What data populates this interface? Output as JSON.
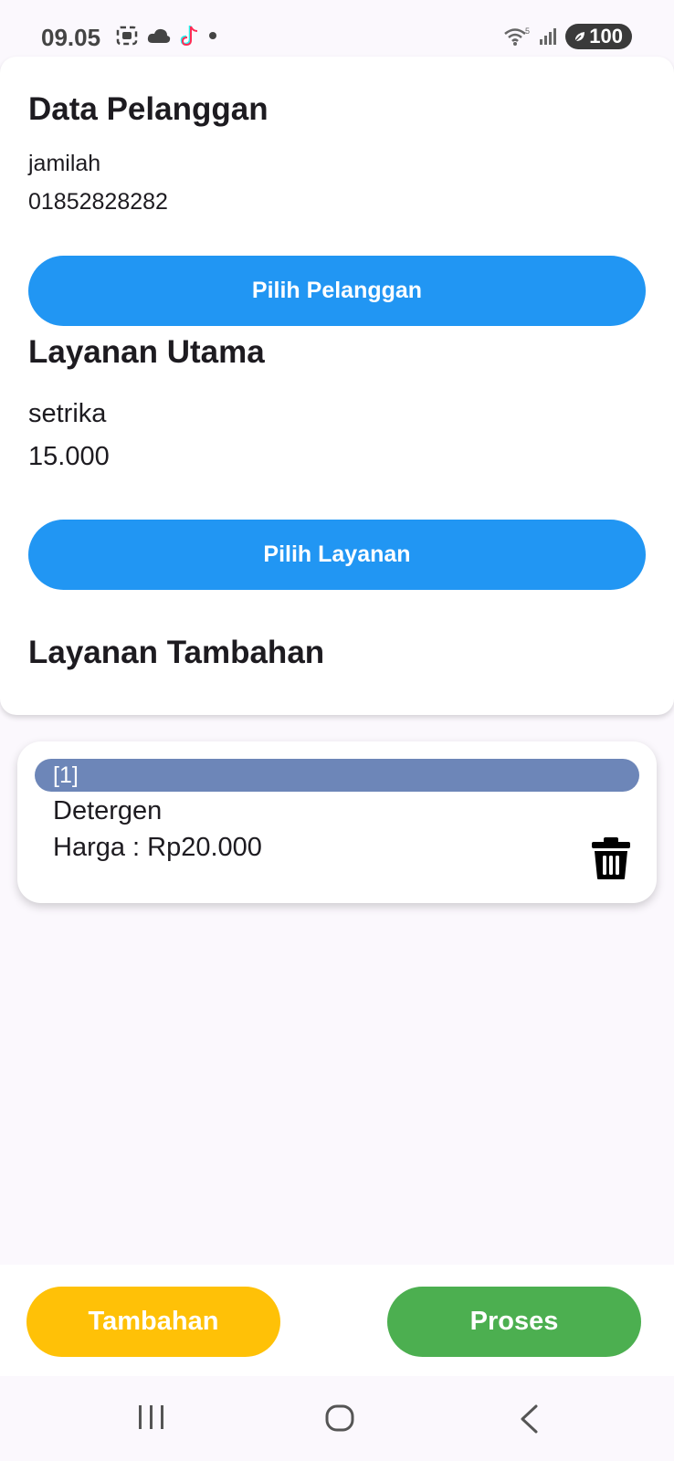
{
  "status_bar": {
    "time": "09.05",
    "battery": "100"
  },
  "customer": {
    "section_title": "Data Pelanggan",
    "name": "jamilah",
    "phone": "01852828282",
    "select_button": "Pilih Pelanggan"
  },
  "main_service": {
    "section_title": "Layanan Utama",
    "name": "setrika",
    "price": "15.000",
    "select_button": "Pilih Layanan"
  },
  "extra_services": {
    "section_title": "Layanan Tambahan",
    "items": [
      {
        "index": "[1]",
        "name": "Detergen",
        "price": "Harga : Rp20.000"
      }
    ]
  },
  "bottom_actions": {
    "add_button": "Tambahan",
    "process_button": "Proses"
  },
  "colors": {
    "primary_blue": "#2196f3",
    "add_yellow": "#ffc107",
    "process_green": "#4caf50",
    "index_chip": "#6d86b8"
  },
  "icons": [
    "screenshot-icon",
    "cloud-icon",
    "tiktok-icon",
    "wifi-icon",
    "signal-icon",
    "battery-icon",
    "trash-icon",
    "recents-icon",
    "home-icon",
    "back-icon"
  ]
}
